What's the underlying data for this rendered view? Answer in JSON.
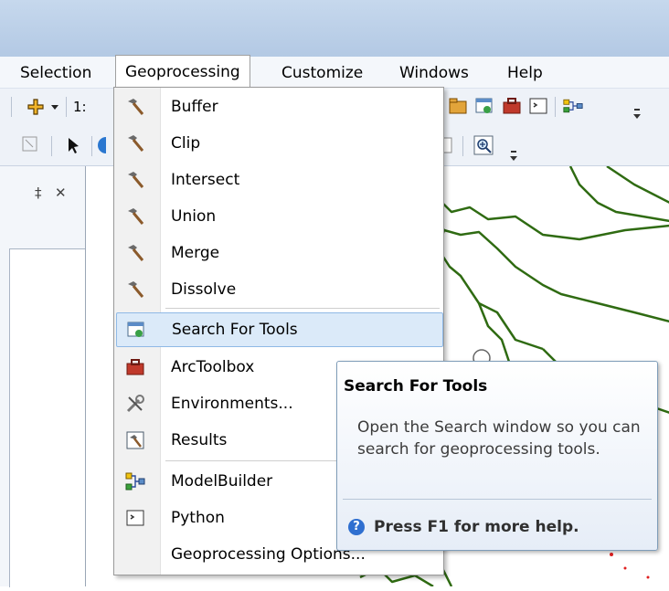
{
  "menu_bar": {
    "items": [
      {
        "label": "Selection"
      },
      {
        "label": "Geoprocessing"
      },
      {
        "label": "Customize"
      },
      {
        "label": "Windows"
      },
      {
        "label": "Help"
      }
    ]
  },
  "toolbar": {
    "scale_prefix": "1:"
  },
  "dock": {
    "pin_glyph": "‡",
    "close_glyph": "✕"
  },
  "geoprocessing_menu": {
    "items": [
      {
        "label": "Buffer",
        "icon": "hammer-icon"
      },
      {
        "label": "Clip",
        "icon": "hammer-icon"
      },
      {
        "label": "Intersect",
        "icon": "hammer-icon"
      },
      {
        "label": "Union",
        "icon": "hammer-icon"
      },
      {
        "label": "Merge",
        "icon": "hammer-icon"
      },
      {
        "label": "Dissolve",
        "icon": "hammer-icon"
      },
      {
        "label": "Search For Tools",
        "icon": "search-window-icon",
        "highlighted": true
      },
      {
        "label": "ArcToolbox",
        "icon": "toolbox-icon"
      },
      {
        "label": "Environments...",
        "icon": "environments-icon"
      },
      {
        "label": "Results",
        "icon": "results-icon"
      },
      {
        "label": "ModelBuilder",
        "icon": "modelbuilder-icon"
      },
      {
        "label": "Python",
        "icon": "python-window-icon"
      },
      {
        "label": "Geoprocessing Options...",
        "icon": ""
      }
    ]
  },
  "tooltip": {
    "title": "Search For Tools",
    "body": "Open the Search window so you can search for geoprocessing tools.",
    "help": "Press F1 for more help."
  },
  "colors": {
    "map_line": "#2f6b12",
    "menu_highlight": "#dbeaf9",
    "title_bar": "#c6d8ed"
  }
}
